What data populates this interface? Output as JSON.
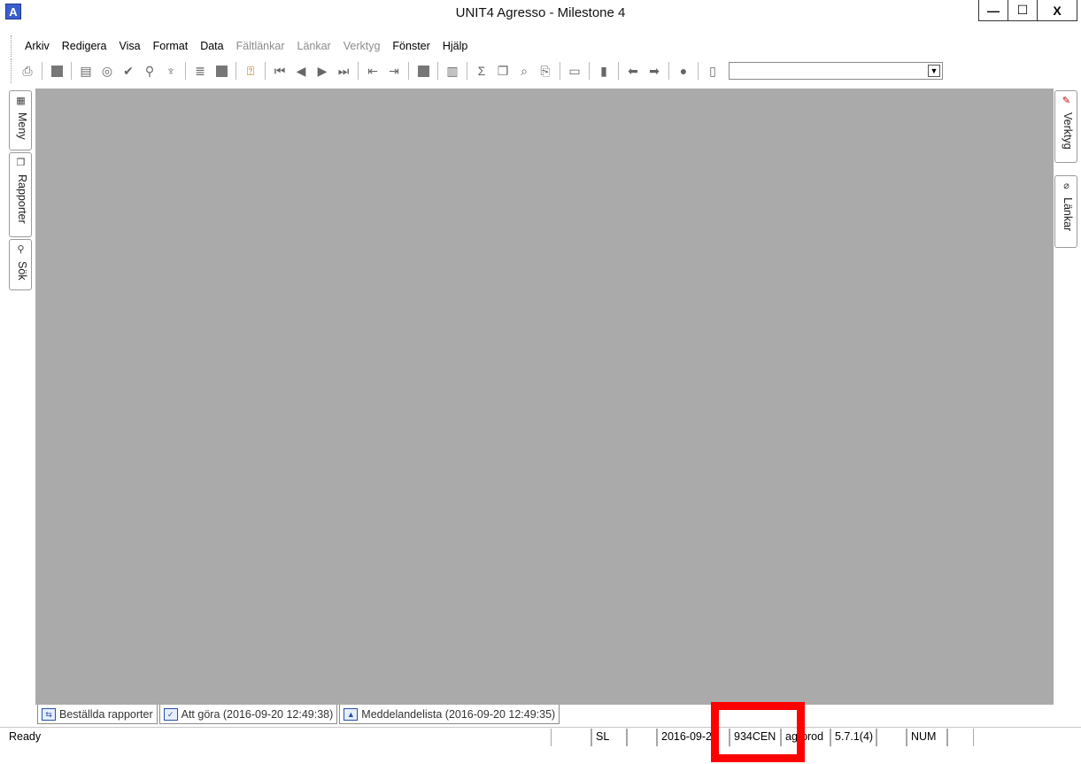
{
  "window": {
    "title": "UNIT4 Agresso - Milestone 4",
    "app_icon_letter": "A",
    "minimize": "—",
    "maximize": "☐",
    "close": "X"
  },
  "menu": [
    {
      "label": "Arkiv",
      "enabled": true
    },
    {
      "label": "Redigera",
      "enabled": true
    },
    {
      "label": "Visa",
      "enabled": true
    },
    {
      "label": "Format",
      "enabled": true
    },
    {
      "label": "Data",
      "enabled": true
    },
    {
      "label": "Fältlänkar",
      "enabled": false
    },
    {
      "label": "Länkar",
      "enabled": false
    },
    {
      "label": "Verktyg",
      "enabled": false
    },
    {
      "label": "Fönster",
      "enabled": true
    },
    {
      "label": "Hjälp",
      "enabled": true
    }
  ],
  "toolbar_combo_value": "",
  "left_tabs": [
    {
      "label": "Meny",
      "icon": "menu-grid-icon"
    },
    {
      "label": "Rapporter",
      "icon": "reports-icon"
    },
    {
      "label": "Sök",
      "icon": "search-icon"
    }
  ],
  "right_tabs": [
    {
      "label": "Verktyg",
      "icon": "tools-icon"
    },
    {
      "label": "Länkar",
      "icon": "paperclip-icon"
    }
  ],
  "bottom_tabs": [
    {
      "label": "Beställda rapporter",
      "icon": "ordered-reports-icon"
    },
    {
      "label": "Att göra (2016-09-20 12:49:38)",
      "icon": "todo-check-icon"
    },
    {
      "label": "Meddelandelista (2016-09-20 12:49:35)",
      "icon": "message-list-icon"
    }
  ],
  "status": {
    "ready": "Ready",
    "sl": "SL",
    "date": "2016-09-20",
    "client": "934CEN",
    "db": "agrprod",
    "version": "5.7.1(4)",
    "num": "NUM"
  },
  "colors": {
    "workarea": "#aaaaaa",
    "highlight_box": "#ff0000"
  }
}
